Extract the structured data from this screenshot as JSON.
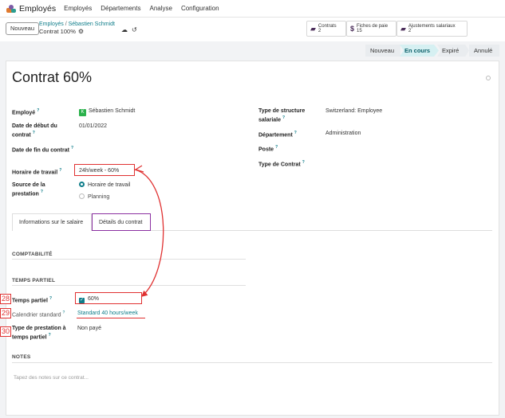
{
  "navbar": {
    "app_name": "Employés",
    "items": [
      "Employés",
      "Départements",
      "Analyse",
      "Configuration"
    ]
  },
  "control": {
    "new_button": "Nouveau",
    "breadcrumb_root": "Employés",
    "breadcrumb_sep": "/",
    "breadcrumb_employee": "Sébastien Schmidt",
    "record_name": "Contrat 100%"
  },
  "smart_buttons": {
    "contrats": {
      "label": "Contrats",
      "count": "2"
    },
    "fiches": {
      "label": "Fiches de paie",
      "count": "15"
    },
    "ajustements": {
      "label": "Ajustements salariaux",
      "count": "2"
    }
  },
  "status": {
    "stages": [
      "Nouveau",
      "En cours",
      "Expiré",
      "Annulé"
    ],
    "current": "En cours"
  },
  "form": {
    "title": "Contrat 60%",
    "employee_label": "Employé",
    "employee_initial": "K",
    "employee_value": "Sébastien Schmidt",
    "start_label": "Date de début du contrat",
    "start_value": "01/01/2022",
    "end_label": "Date de fin du contrat",
    "schedule_label": "Horaire de travail",
    "schedule_value": "24h/week - 60%",
    "source_label": "Source de la prestation",
    "source_options": [
      "Horaire de travail",
      "Planning"
    ],
    "structure_label": "Type de structure salariale",
    "structure_value": "Switzerland: Employee",
    "department_label": "Département",
    "department_value": "Administration",
    "position_label": "Poste",
    "contract_type_label": "Type de Contrat"
  },
  "tabs": [
    "Informations sur le salaire",
    "Détails du contrat"
  ],
  "details": {
    "accounting_section": "COMPTABILITÉ",
    "part_time_section": "TEMPS PARTIEL",
    "part_time_label": "Temps partiel",
    "part_time_value": "60%",
    "calendar_label": "Calendrier standard",
    "calendar_value": "Standard 40 hours/week",
    "part_time_type_label": "Type de prestation à temps partiel",
    "part_time_type_value": "Non payé",
    "notes_section": "NOTES",
    "notes_placeholder": "Tapez des notes sur ce contrat..."
  },
  "annotations": {
    "steps": [
      "28",
      "29",
      "30"
    ]
  },
  "colors": {
    "accent": "#0f7d8a",
    "highlight_red": "#e03131",
    "highlight_purple": "#8a2fa0"
  }
}
